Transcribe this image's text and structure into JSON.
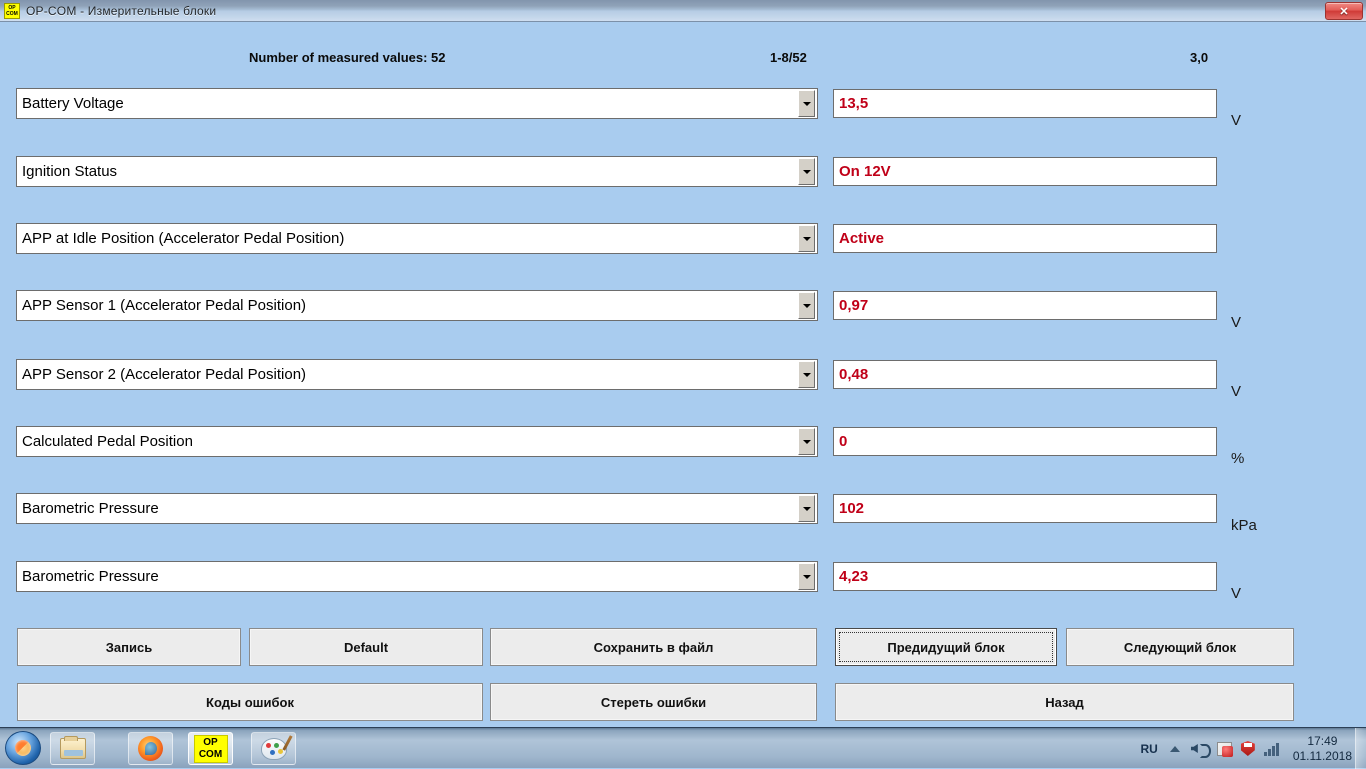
{
  "window": {
    "title": "OP-COM - Измерительные блоки",
    "icon_label_top": "OP",
    "icon_label_bottom": "COM",
    "close_label": "✕"
  },
  "header": {
    "count_label": "Number of measured values: 52",
    "range_label": "1-8/52",
    "version_label": "3,0"
  },
  "rows": [
    {
      "name": "Battery Voltage",
      "value": "13,5",
      "unit": "V"
    },
    {
      "name": "Ignition Status",
      "value": "On  12V",
      "unit": ""
    },
    {
      "name": "APP at Idle Position (Accelerator Pedal Position)",
      "value": "Active",
      "unit": ""
    },
    {
      "name": "APP Sensor 1 (Accelerator Pedal Position)",
      "value": "0,97",
      "unit": "V"
    },
    {
      "name": "APP Sensor 2 (Accelerator Pedal Position)",
      "value": "0,48",
      "unit": "V"
    },
    {
      "name": "Calculated Pedal Position",
      "value": "0",
      "unit": "%"
    },
    {
      "name": "Barometric Pressure",
      "value": "102",
      "unit": "kPa"
    },
    {
      "name": "Barometric Pressure",
      "value": "4,23",
      "unit": "V"
    }
  ],
  "buttons": {
    "record": "Запись",
    "default": "Default",
    "save_to_file": "Сохранить в файл",
    "previous_block": "Предидущий блок",
    "next_block": "Следующий блок",
    "error_codes": "Коды ошибок",
    "clear_errors": "Стереть ошибки",
    "back": "Назад"
  },
  "taskbar": {
    "items": [
      {
        "name": "explorer",
        "label": ""
      },
      {
        "name": "firefox",
        "label": ""
      },
      {
        "name": "opcom",
        "label_top": "OP",
        "label_bottom": "COM"
      },
      {
        "name": "paint",
        "label": ""
      }
    ],
    "tray": {
      "language": "RU",
      "time": "17:49",
      "date": "01.11.2018"
    }
  },
  "colors": {
    "background": "#a9ccef",
    "value_text": "#c00018",
    "field_background": "#ffffff",
    "button_face": "#ececec"
  }
}
